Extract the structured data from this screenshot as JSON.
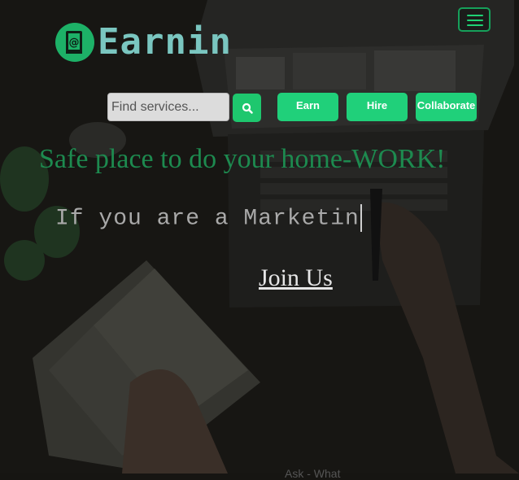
{
  "header": {
    "logo_text": "Earnin",
    "logo_icon": "notebook-at-icon",
    "menu_icon": "hamburger-icon"
  },
  "search": {
    "placeholder": "Find services...",
    "button_icon": "search-icon"
  },
  "nav": {
    "earn_label": "Earn",
    "hire_label": "Hire",
    "collaborate_label": "Collaborate"
  },
  "hero": {
    "tagline": "Safe place to do your home-WORK!",
    "typed_text": "If you are a Marketin",
    "join_label": "Join Us",
    "bottom_partial": "Ask  -  What"
  },
  "colors": {
    "accent": "#20d07a",
    "tagline": "#1d8a4f",
    "logo_badge": "#1db167",
    "logo_text": "#7ac6c0",
    "background": "#161512"
  }
}
